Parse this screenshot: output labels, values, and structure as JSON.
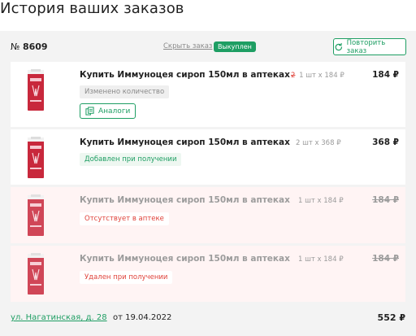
{
  "page": {
    "title": "История ваших заказов"
  },
  "order": {
    "number_prefix": "№",
    "number": "8609",
    "hide_label": "Скрыть заказ",
    "status": "Выкуплен",
    "repeat_label": "Повторить заказ",
    "address": "ул. Нагатинская, д. 28",
    "date": "от 19.04.2022",
    "total": "552 ₽",
    "items": [
      {
        "name": "Купить Иммуноцея сироп 150мл в аптеках",
        "old_qty": "2",
        "qty": "1 шт x 184 ₽",
        "price": "184 ₽",
        "note": "Изменено количество",
        "analogs": "Аналоги"
      },
      {
        "name": "Купить Иммуноцея сироп 150мл в аптеках",
        "qty": "2 шт x 368 ₽",
        "price": "368 ₽",
        "note": "Добавлен при получении"
      },
      {
        "name": "Купить Иммуноцея сироп 150мл в аптеках",
        "qty": "1 шт x 184 ₽",
        "price": "184 ₽",
        "note": "Отсутствует в аптеке"
      },
      {
        "name": "Купить Иммуноцея сироп 150мл в аптеках",
        "qty": "1 шт x 184 ₽",
        "price": "184 ₽",
        "note": "Удален при получении"
      }
    ]
  },
  "colors": {
    "accent": "#1e9e63",
    "danger": "#e0423a",
    "card_bg": "#f3f3f3",
    "unavailable_bg": "#fff4f4"
  },
  "icons": {
    "repeat": "refresh-icon",
    "analogs": "copy-icon",
    "product": "product-image"
  }
}
